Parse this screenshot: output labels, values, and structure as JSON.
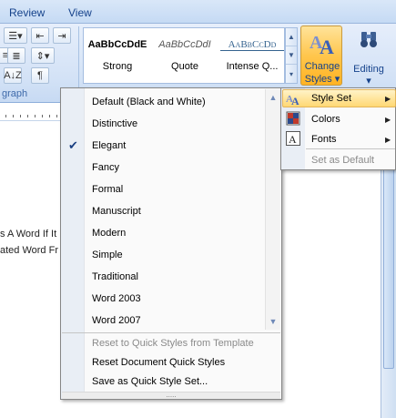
{
  "tabs": [
    "Review",
    "View"
  ],
  "ribbon": {
    "paragraph_group_label": "graph",
    "gallery": [
      {
        "sample": "AaBbCcDdE",
        "name": "Strong"
      },
      {
        "sample": "AaBbCcDdI",
        "name": "Quote"
      },
      {
        "sample": "AaBbCcDd",
        "name": "Intense Q..."
      }
    ],
    "change_styles": {
      "line1": "Change",
      "line2": "Styles",
      "caret": "▾"
    },
    "editing": {
      "label": "Editing",
      "caret": "▾"
    },
    "pilcrow": "¶",
    "sort_label": "A↓Z"
  },
  "document": {
    "line1": "s A Word If It",
    "line2": "ated Word Fr"
  },
  "style_set_menu": {
    "items": [
      {
        "label": "Default (Black and White)",
        "checked": false
      },
      {
        "label": "Distinctive",
        "checked": false
      },
      {
        "label": "Elegant",
        "checked": true
      },
      {
        "label": "Fancy",
        "checked": false
      },
      {
        "label": "Formal",
        "checked": false
      },
      {
        "label": "Manuscript",
        "checked": false
      },
      {
        "label": "Modern",
        "checked": false
      },
      {
        "label": "Simple",
        "checked": false
      },
      {
        "label": "Traditional",
        "checked": false
      },
      {
        "label": "Word 2003",
        "checked": false
      },
      {
        "label": "Word 2007",
        "checked": false
      }
    ],
    "check_mark": "✔",
    "scroll_up": "▲",
    "scroll_down": "▼",
    "actions": [
      {
        "label": "Reset to Quick Styles from Template",
        "disabled": true
      },
      {
        "label": "Reset Document Quick Styles",
        "disabled": false
      },
      {
        "label": "Save as Quick Style Set...",
        "disabled": false
      }
    ],
    "grip": "....."
  },
  "submenu": {
    "items": [
      {
        "label": "Style Set",
        "arrow": "▶",
        "icon": "style-set-icon"
      },
      {
        "label": "Colors",
        "arrow": "▶",
        "icon": "colors-icon"
      },
      {
        "label": "Fonts",
        "arrow": "▶",
        "icon": "fonts-icon"
      },
      {
        "label": "Set as Default",
        "arrow": "",
        "icon": ""
      }
    ],
    "fonts_icon_glyph": "A",
    "style_set_icon_glyph": "A"
  },
  "colors": {
    "ribbon_text": "#15428b",
    "highlight": "#ffd874",
    "check": "#1a3f82"
  }
}
